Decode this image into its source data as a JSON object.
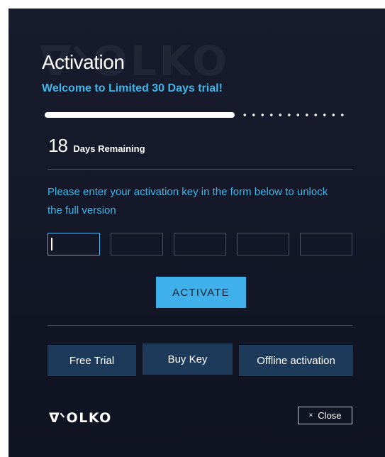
{
  "brand": {
    "logo_text": "VOLKO",
    "watermark_text": "VOLKO"
  },
  "header": {
    "title": "Activation",
    "subtitle": "Welcome to Limited 30 Days trial!"
  },
  "trial": {
    "progress_fraction": 0.63,
    "days_number": "18",
    "days_label": "Days Remaining"
  },
  "form": {
    "instructions": "Please enter your activation key in the form below to unlock the full version",
    "key_fields": [
      "",
      "",
      "",
      "",
      ""
    ],
    "activate_label": "ACTIVATE"
  },
  "actions": {
    "free_trial_label": "Free Trial",
    "buy_key_label": "Buy Key",
    "offline_label": "Offline activation"
  },
  "footer": {
    "close_label": "Close",
    "close_glyph": "×"
  },
  "colors": {
    "accent": "#3eb6ea",
    "button_primary": "#3fb0ea",
    "button_secondary": "#1e3a5a",
    "background": "#151929"
  }
}
